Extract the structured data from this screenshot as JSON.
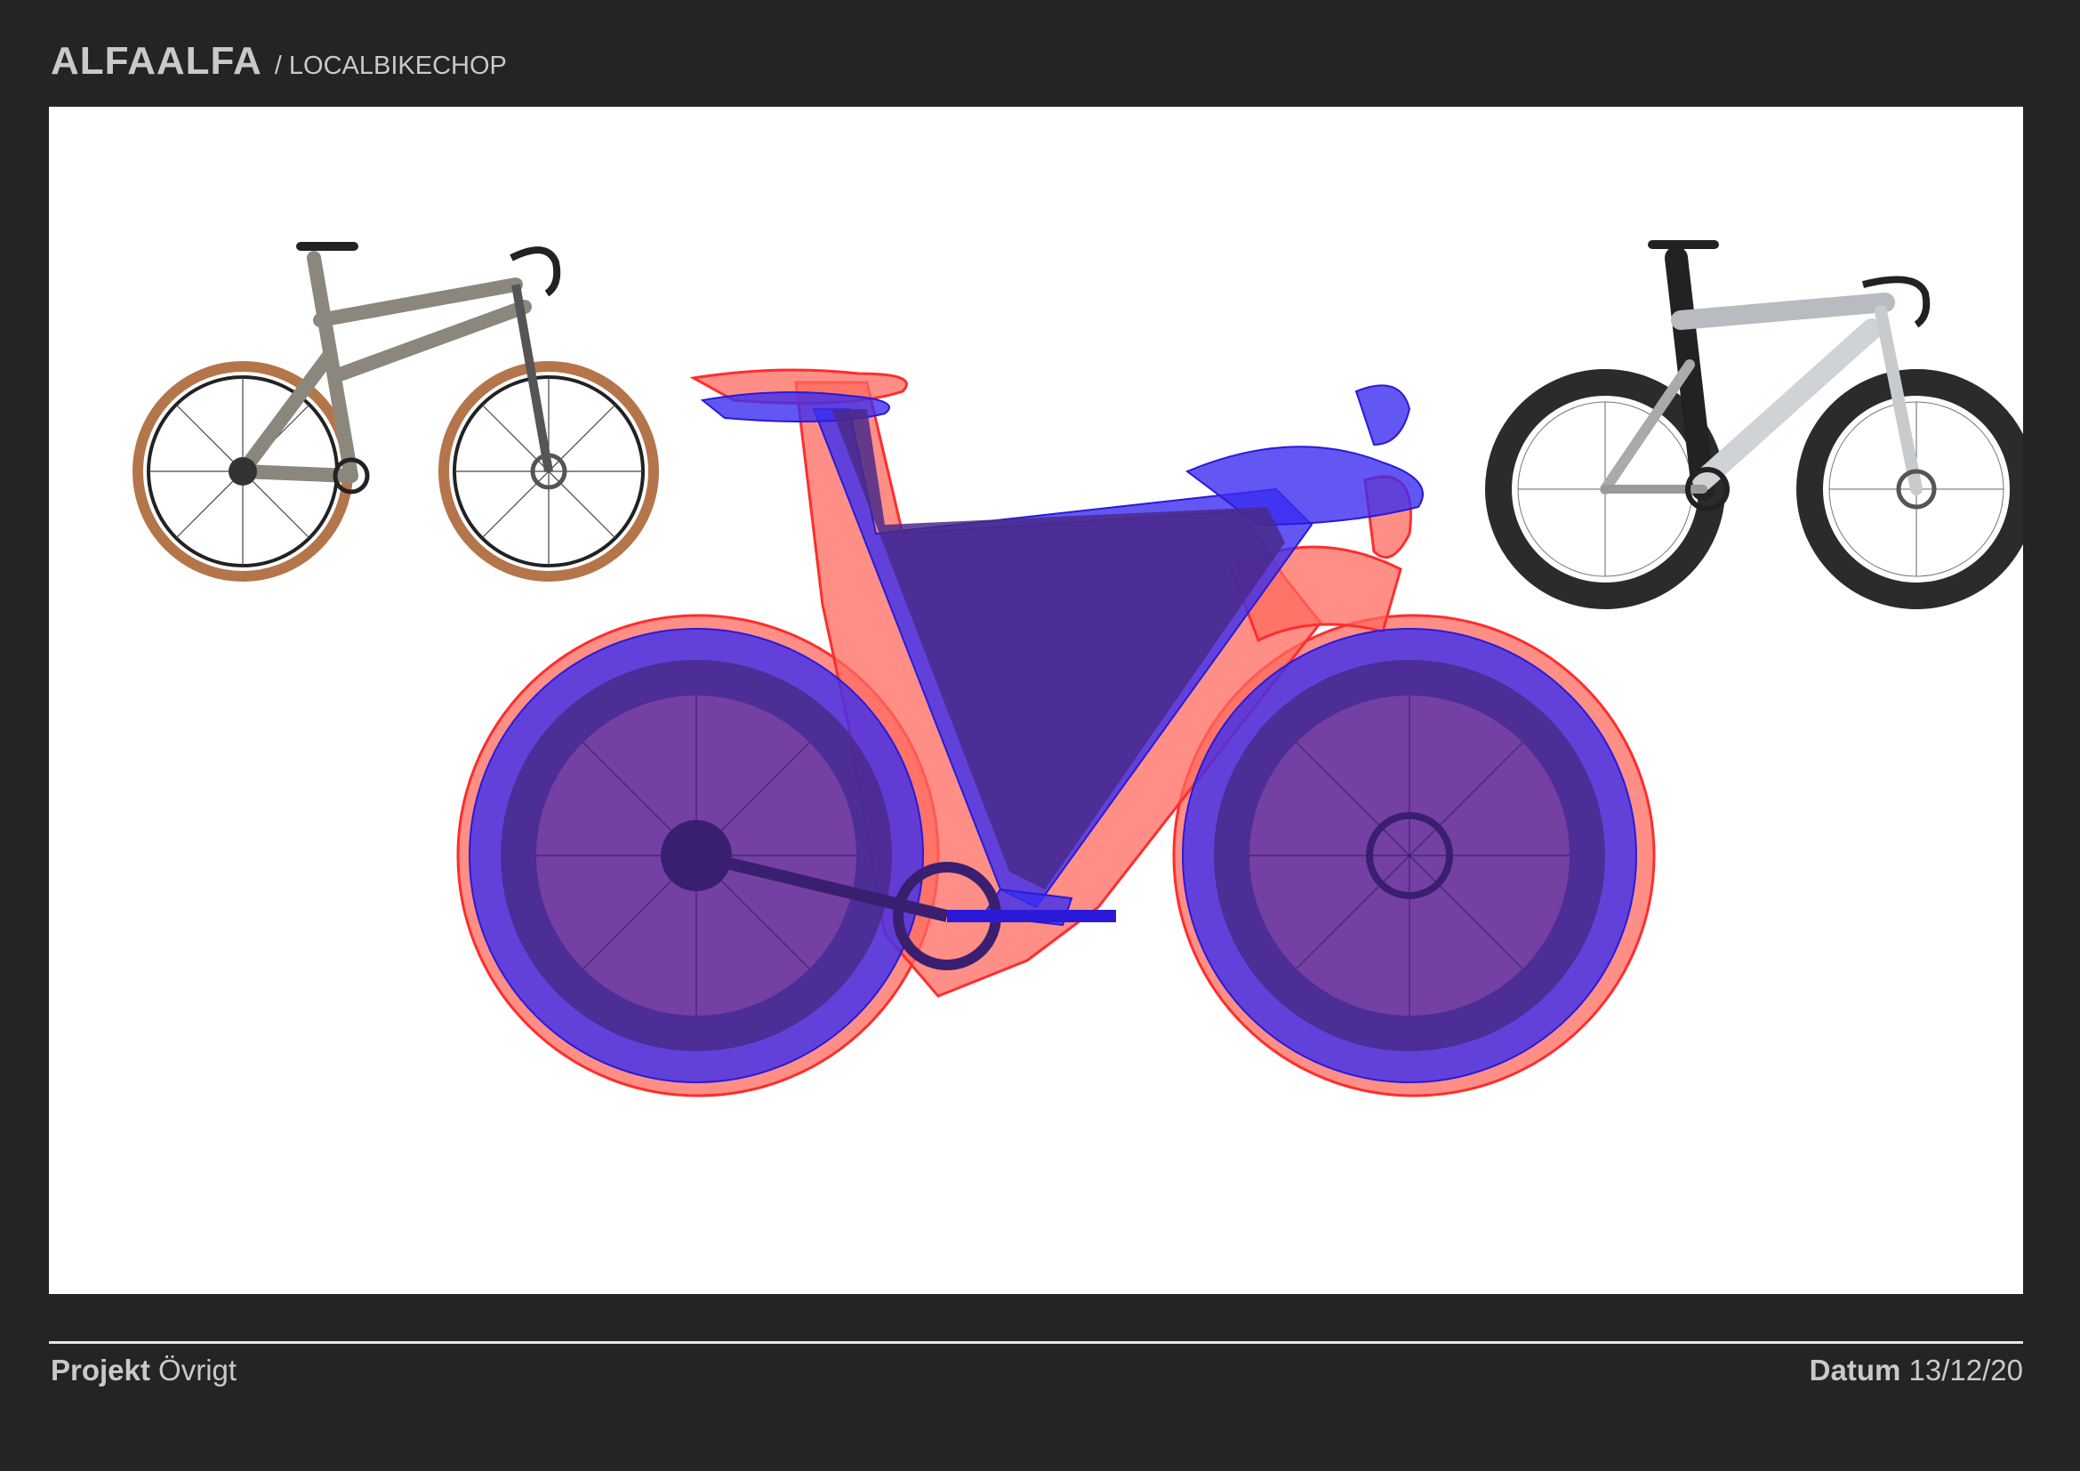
{
  "header": {
    "brand": "ALFAALFA",
    "sub": "/ LOCALBIKECHOP"
  },
  "footer": {
    "project_label": "Projekt",
    "project_value": "Övrigt",
    "date_label": "Datum",
    "date_value": "13/12/20"
  },
  "colors": {
    "background": "#242424",
    "canvas": "#ffffff",
    "overlay_red": "#ff6a5e",
    "overlay_blue": "#3b2df0",
    "overlay_purple": "#4a2a8a"
  },
  "images": {
    "gravel_bike": "gravel-bike-photo",
    "overlay_bike": "overlay-comparison-bike",
    "aero_bike": "aero-road-bike-photo"
  }
}
